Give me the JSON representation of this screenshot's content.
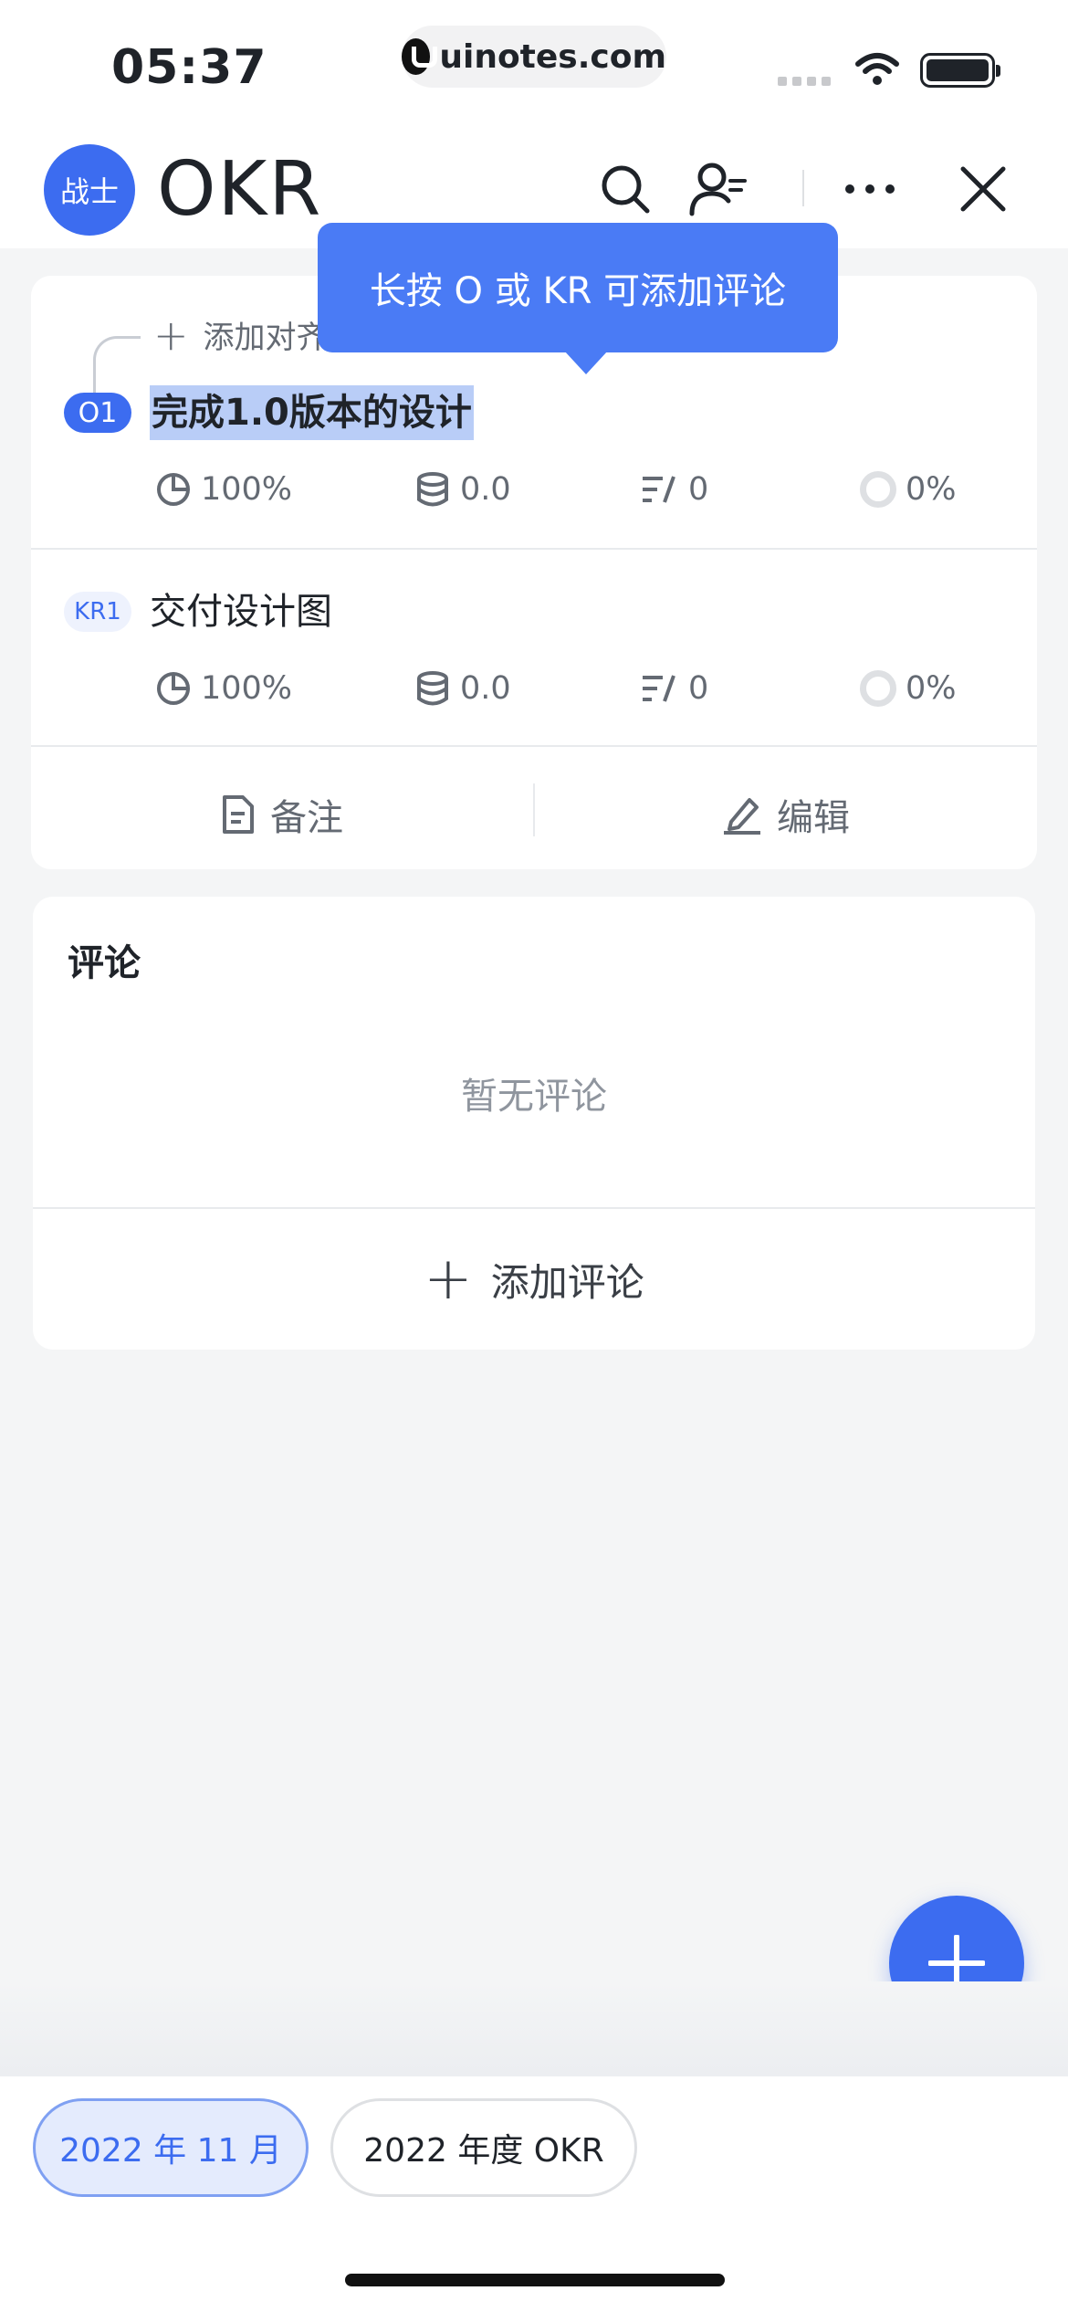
{
  "status_bar": {
    "time": "05:37",
    "url": "uinotes.com",
    "icons": [
      "signal-icon",
      "wifi-icon",
      "battery-icon"
    ]
  },
  "nav": {
    "avatar_text": "战士",
    "title": "OKR",
    "icons": [
      "search-icon",
      "member-icon",
      "more-icon",
      "close-icon"
    ]
  },
  "tooltip": {
    "text": "长按 O 或 KR 可添加评论"
  },
  "objective": {
    "add_alignment_label": "添加对齐",
    "badge": "O1",
    "title": "完成1.0版本的设计",
    "metrics": {
      "progress": "100%",
      "weight": "0.0",
      "tasks": "0",
      "score": "0%"
    }
  },
  "key_results": [
    {
      "badge": "KR1",
      "title": "交付设计图",
      "metrics": {
        "progress": "100%",
        "weight": "0.0",
        "tasks": "0",
        "score": "0%"
      }
    }
  ],
  "actions": {
    "note_label": "备注",
    "edit_label": "编辑"
  },
  "comments": {
    "title": "评论",
    "empty_text": "暂无评论",
    "add_label": "添加评论"
  },
  "periods": [
    {
      "label": "2022 年 11 月",
      "active": true
    },
    {
      "label": "2022 年度 OKR",
      "active": false
    }
  ],
  "colors": {
    "accent": "#3c6cf0",
    "tooltip": "#4a7bf5",
    "selection": "#b9cdf7",
    "muted_text": "#646a73",
    "background": "#f4f5f6"
  }
}
